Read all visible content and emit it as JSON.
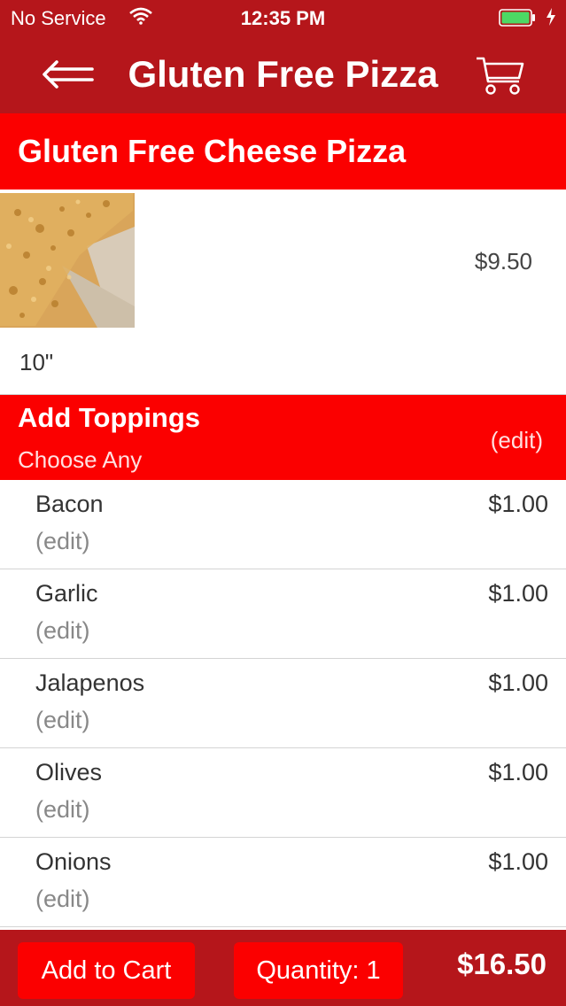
{
  "status_bar": {
    "carrier": "No Service",
    "time": "12:35 PM"
  },
  "nav": {
    "title": "Gluten Free Pizza",
    "back_icon": "back-arrow-icon",
    "cart_icon": "cart-icon"
  },
  "item": {
    "name": "Gluten Free Cheese Pizza",
    "price": "$9.50",
    "size": "10\""
  },
  "toppings_section": {
    "title": "Add Toppings",
    "subtitle": "Choose Any",
    "edit_label": "(edit)"
  },
  "toppings": [
    {
      "name": "Bacon",
      "edit": "(edit)",
      "price": "$1.00"
    },
    {
      "name": "Garlic",
      "edit": "(edit)",
      "price": "$1.00"
    },
    {
      "name": "Jalapenos",
      "edit": "(edit)",
      "price": "$1.00"
    },
    {
      "name": "Olives",
      "edit": "(edit)",
      "price": "$1.00"
    },
    {
      "name": "Onions",
      "edit": "(edit)",
      "price": "$1.00"
    }
  ],
  "footer": {
    "add_to_cart": "Add to Cart",
    "quantity": "Quantity: 1",
    "total": "$16.50"
  },
  "colors": {
    "bar_red": "#b5161b",
    "accent_red": "#fb0000"
  }
}
